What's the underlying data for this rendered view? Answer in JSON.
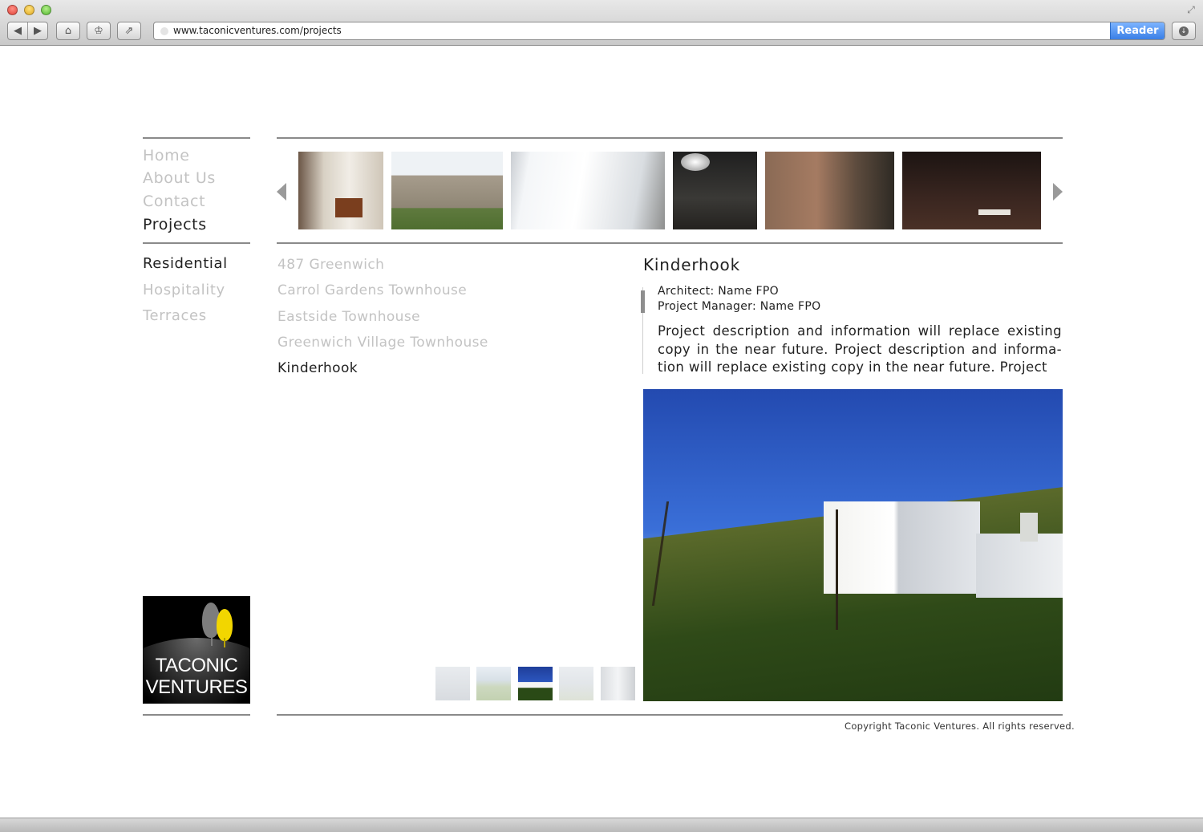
{
  "browser": {
    "url": "www.taconicventures.com/projects",
    "reader_label": "Reader",
    "nav_back_icon": "◀",
    "nav_forward_icon": "▶",
    "home_icon": "⌂",
    "bookmarks_icon": "♔",
    "share_icon": "⇗",
    "download_icon": "↓",
    "resize_icon": "⤢"
  },
  "nav": {
    "items": [
      {
        "label": "Home"
      },
      {
        "label": "About Us"
      },
      {
        "label": "Contact"
      },
      {
        "label": "Projects"
      }
    ],
    "active": "Projects"
  },
  "categories": {
    "items": [
      {
        "label": "Residential"
      },
      {
        "label": "Hospitality"
      },
      {
        "label": "Terraces"
      }
    ],
    "active": "Residential"
  },
  "projects": {
    "items": [
      {
        "label": "487 Greenwich"
      },
      {
        "label": "Carrol Gardens Townhouse"
      },
      {
        "label": "Eastside Townhouse"
      },
      {
        "label": "Greenwich Village Townhouse"
      },
      {
        "label": "Kinderhook"
      }
    ],
    "active": "Kinderhook"
  },
  "detail": {
    "title": "Kinderhook",
    "architect": "Architect: Name FPO",
    "manager": "Project Manager: Name FPO",
    "description": "Project description and information will replace existing copy in the near future. Project description and informa-tion will replace existing copy in the near future. Project"
  },
  "logo": {
    "line1": "TACONIC",
    "line2": "VENTURES"
  },
  "footer": {
    "copyright": "Copyright Taconic Ventures. All rights reserved."
  },
  "colors": {
    "text_active": "#222222",
    "text_inactive": "#c3c3c3",
    "rule": "#8a8a8a",
    "reader_button": "#3a7fe6",
    "logo_leaf_yellow": "#f2d600"
  }
}
